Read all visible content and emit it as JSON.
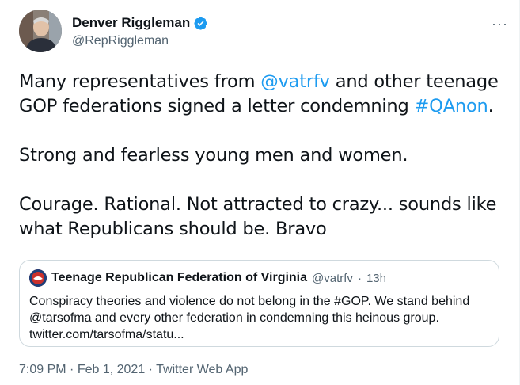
{
  "author": {
    "display_name": "Denver Riggleman",
    "handle": "@RepRiggleman",
    "verified_icon": "verified-badge",
    "more_label": "···"
  },
  "tweet": {
    "line1_pre": "Many representatives from ",
    "mention_vatrfv": "@vatrfv",
    "line1_mid": " and other teenage GOP federations signed a letter condemning ",
    "hashtag_qanon": "#QAnon",
    "line1_post": ".",
    "line2": "Strong and fearless young men and women.",
    "line3": "Courage. Rational. Not attracted to crazy... sounds like what Republicans should be. Bravo"
  },
  "quote": {
    "name": "Teenage Republican Federation of Virginia",
    "handle": "@vatrfv",
    "separator": "·",
    "time": "13h",
    "line1": "Conspiracy theories and violence do not belong in the #GOP. We stand behind",
    "line2": "@tarsofma and every other federation in condemning this heinous group.",
    "line3": "twitter.com/tarsofma/statu..."
  },
  "meta": {
    "time": "7:09 PM",
    "sep1": " · ",
    "date": "Feb 1, 2021",
    "sep2": " · ",
    "source": "Twitter Web App"
  }
}
